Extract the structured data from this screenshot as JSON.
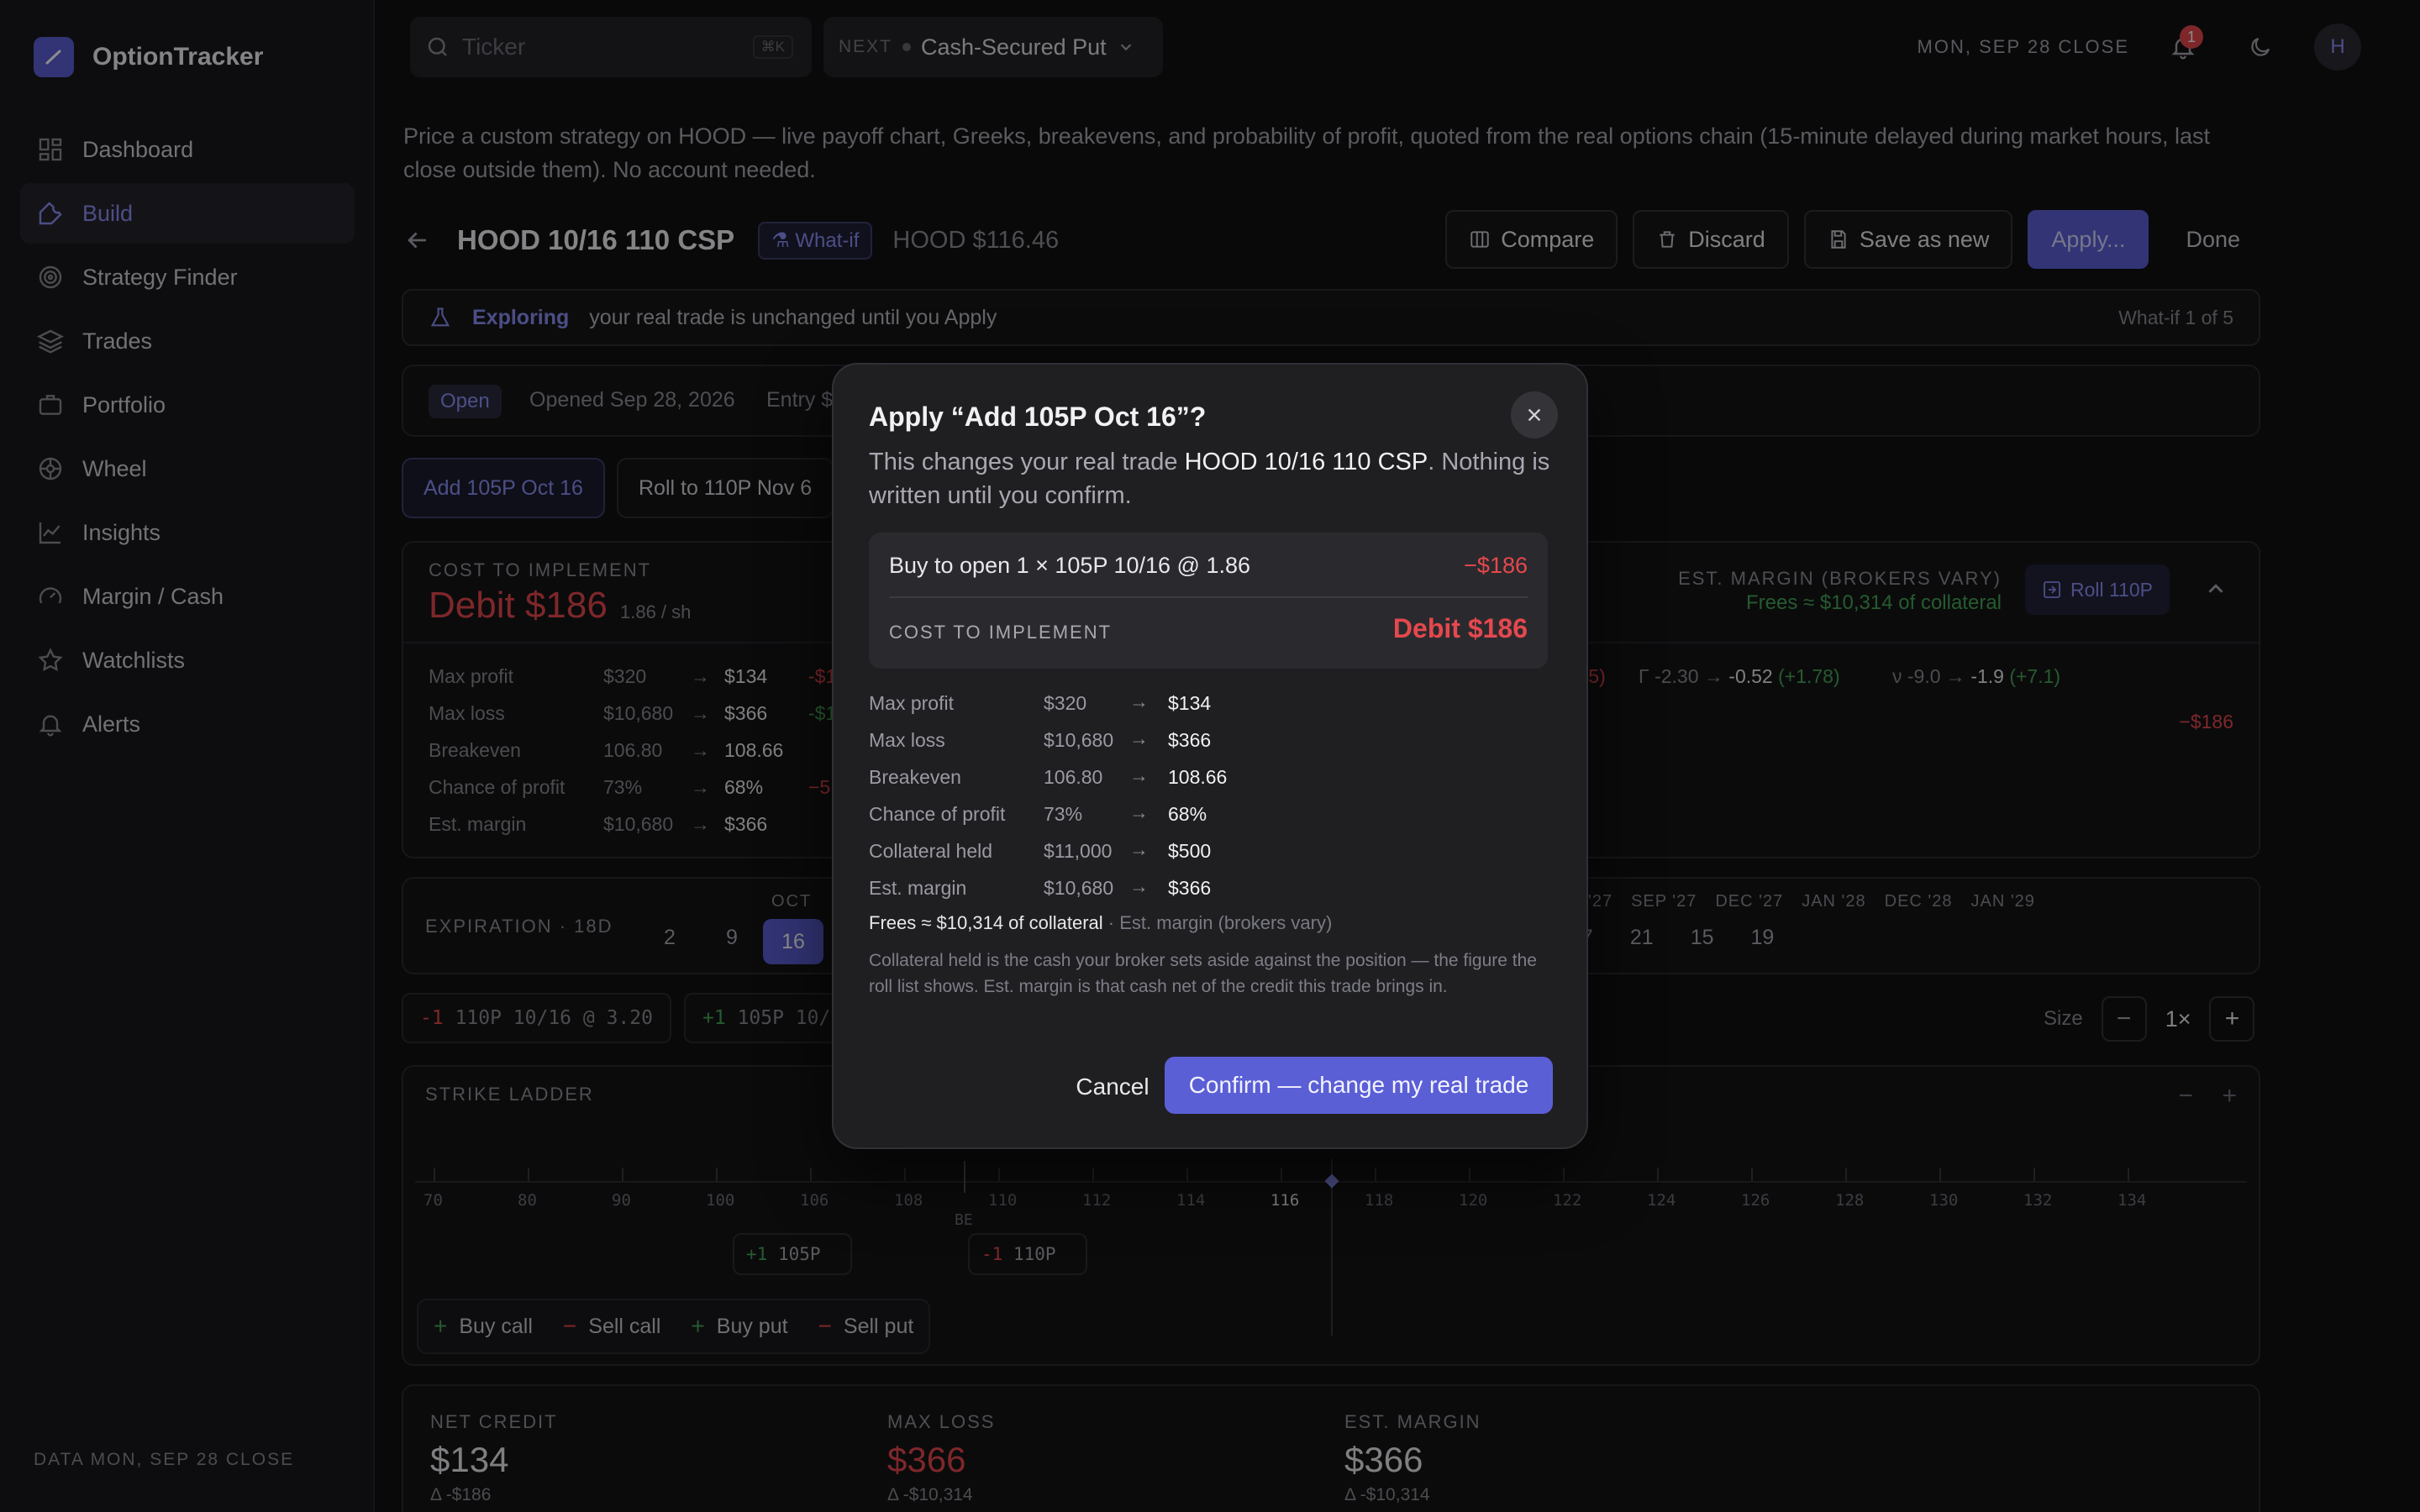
{
  "app": {
    "name": "OptionTracker"
  },
  "sidebar": {
    "items": [
      {
        "label": "Dashboard",
        "icon": "dashboard-icon"
      },
      {
        "label": "Build",
        "icon": "wrench-icon",
        "active": true
      },
      {
        "label": "Strategy Finder",
        "icon": "target-icon"
      },
      {
        "label": "Trades",
        "icon": "layers-icon"
      },
      {
        "label": "Portfolio",
        "icon": "briefcase-icon"
      },
      {
        "label": "Wheel",
        "icon": "wheel-icon"
      },
      {
        "label": "Insights",
        "icon": "chart-line-icon"
      },
      {
        "label": "Margin / Cash",
        "icon": "gauge-icon"
      },
      {
        "label": "Watchlists",
        "icon": "star-icon"
      },
      {
        "label": "Alerts",
        "icon": "bell-icon"
      }
    ],
    "footer": "DATA MON, SEP 28 CLOSE"
  },
  "topbar": {
    "search_placeholder": "Ticker",
    "search_shortcut": "⌘K",
    "next_label": "NEXT",
    "next_value": "Cash-Secured Put",
    "date": "MON, SEP 28 CLOSE",
    "notifications": "1",
    "avatar": "H"
  },
  "main": {
    "description": "Price a custom strategy on HOOD — live payoff chart, Greeks, breakevens, and probability of profit, quoted from the real options chain (15-minute delayed during market hours, last close outside them). No account needed.",
    "title": "HOOD 10/16 110 CSP",
    "whatif_badge": "What-if",
    "price": "HOOD $116.46",
    "buttons": {
      "compare": "Compare",
      "discard": "Discard",
      "save": "Save as new",
      "apply": "Apply...",
      "done": "Done"
    },
    "banner": {
      "highlight": "Exploring",
      "text": "your real trade is unchanged until you Apply",
      "right": "What-if 1 of 5"
    },
    "status": {
      "pill": "Open",
      "opened": "Opened Sep 28, 2026",
      "entry": "Entry $"
    },
    "tabs": [
      "Add 105P Oct 16",
      "Roll to 110P Nov 6"
    ],
    "cost": {
      "label": "COST TO IMPLEMENT",
      "value": "Debit $186",
      "per_share": "1.86 / sh",
      "margin_label": "EST. MARGIN (BROKERS VARY)",
      "margin_frees": "Frees ≈ $10,314 of collateral",
      "roll_button": "Roll 110P",
      "rows": [
        {
          "label": "Max profit",
          "from": "$320",
          "to": "$134",
          "delta": "-$186",
          "delta_color": "red"
        },
        {
          "label": "Max loss",
          "from": "$10,680",
          "to": "$366",
          "delta": "-$10,",
          "delta_color": "green"
        },
        {
          "label": "Breakeven",
          "from": "106.80",
          "to": "108.66",
          "delta": "",
          "delta_color": ""
        },
        {
          "label": "Chance of profit",
          "from": "73%",
          "to": "68%",
          "delta": "−5 pts",
          "delta_color": "red"
        },
        {
          "label": "Est. margin",
          "from": "$10,680",
          "to": "$366",
          "delta": "",
          "delta_color": ""
        }
      ],
      "greeks_partial": ".5)",
      "gamma": {
        "sym": "Γ",
        "from": "-2.30",
        "to": "-0.52",
        "delta": "(+1.78)"
      },
      "vega": {
        "sym": "ν",
        "from": "-9.0",
        "to": "-1.9",
        "delta": "(+7.1)"
      },
      "right_value": "−$186"
    },
    "expiration": {
      "label": "EXPIRATION · 18D",
      "month_oct": "OCT",
      "days_left": [
        "2",
        "9",
        "16"
      ],
      "selected": "16",
      "months_right": [
        "'27",
        "SEP '27",
        "DEC '27",
        "JAN '28",
        "DEC '28",
        "JAN '29"
      ],
      "days_right": [
        "7",
        "21",
        "15",
        "19"
      ]
    },
    "legs": [
      {
        "qty": "-1",
        "text": "110P 10/16 @ 3.20"
      },
      {
        "qty": "+1",
        "text": "105P 10/"
      }
    ],
    "size": {
      "label": "Size",
      "value": "1×"
    },
    "ladder": {
      "label": "STRIKE LADDER",
      "strikes": [
        "70",
        "80",
        "90",
        "100",
        "106",
        "108",
        "110",
        "112",
        "114",
        "116",
        "118",
        "120",
        "122",
        "124",
        "126",
        "128",
        "130",
        "132",
        "134"
      ],
      "current": "116",
      "be": "BE",
      "chips": [
        {
          "qty": "+1",
          "strike": "105P"
        },
        {
          "qty": "-1",
          "strike": "110P"
        }
      ],
      "actions": [
        "Buy call",
        "Sell call",
        "Buy put",
        "Sell put"
      ]
    },
    "stats": [
      {
        "label": "NET CREDIT",
        "value": "$134",
        "delta": "Δ -$186"
      },
      {
        "label": "MAX LOSS",
        "value": "$366",
        "delta": "Δ -$10,314"
      },
      {
        "label": "EST. MARGIN",
        "value": "$366",
        "delta": "Δ -$10,314"
      }
    ]
  },
  "modal": {
    "title": "Apply “Add 105P Oct 16”?",
    "sub_pre": "This changes your real trade ",
    "sub_trade": "HOOD 10/16 110 CSP",
    "sub_post": ". Nothing is written until you confirm.",
    "summary_line": "Buy to open 1 × 105P 10/16 @ 1.86",
    "summary_amount": "−$186",
    "cost_label": "COST TO IMPLEMENT",
    "cost_value": "Debit $186",
    "rows": [
      {
        "label": "Max profit",
        "from": "$320",
        "to": "$134"
      },
      {
        "label": "Max loss",
        "from": "$10,680",
        "to": "$366"
      },
      {
        "label": "Breakeven",
        "from": "106.80",
        "to": "108.66"
      },
      {
        "label": "Chance of profit",
        "from": "73%",
        "to": "68%"
      },
      {
        "label": "Collateral held",
        "from": "$11,000",
        "to": "$500"
      },
      {
        "label": "Est. margin",
        "from": "$10,680",
        "to": "$366"
      }
    ],
    "frees": "Frees ≈ $10,314 of collateral",
    "frees_note": " · Est. margin (brokers vary)",
    "note": "Collateral held is the cash your broker sets aside against the position — the figure the roll list shows. Est. margin is that cash net of the credit this trade brings in.",
    "cancel": "Cancel",
    "confirm": "Confirm — change my real trade"
  }
}
